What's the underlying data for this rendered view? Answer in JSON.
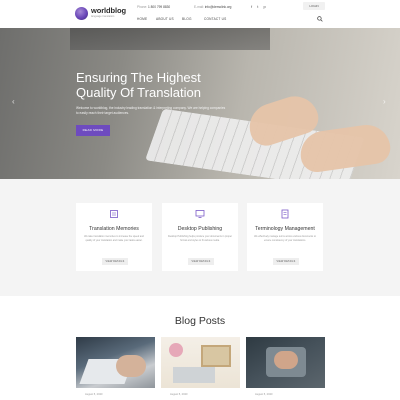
{
  "header": {
    "logo_title": "worldblog",
    "logo_subtitle": "language translation",
    "phone_label": "Phone:",
    "phone": "1 800 799 8830",
    "email_label": "E-mail:",
    "email": "info@demolink.org",
    "social": [
      "f",
      "t",
      "p"
    ],
    "login_label": "LOGIN",
    "nav": [
      "HOME",
      "ABOUT US",
      "BLOG",
      "CONTACT US"
    ]
  },
  "hero": {
    "title_line1": "Ensuring The Highest",
    "title_line2": "Quality Of Translation",
    "text": "Welcome to worldblog, the industry leading translation & interpreting company. We are helping companies to easily reach their target audiences.",
    "button_label": "READ MORE"
  },
  "services": [
    {
      "title": "Translation Memories",
      "desc": "We take translation memories to increase the speed and quality of your translation and make your tasks easier.",
      "button": "VIEW DETAILS",
      "icon": "document-icon"
    },
    {
      "title": "Desktop Publishing",
      "desc": "Desktop Publishing helps produce your documents in proper format and styles to fit various media.",
      "button": "VIEW DETAILS",
      "icon": "monitor-icon"
    },
    {
      "title": "Terminology Management",
      "desc": "We effectively manage terms across various documents to ensure consistency of your translations.",
      "button": "VIEW DETAILS",
      "icon": "list-icon"
    }
  ],
  "blog": {
    "title": "Blog Posts",
    "posts": [
      {
        "date": "August 5, 2020"
      },
      {
        "date": "August 5, 2020"
      },
      {
        "date": "August 5, 2020"
      }
    ]
  },
  "colors": {
    "accent": "#6e4bbf",
    "section_bg": "#f4f4f4"
  }
}
